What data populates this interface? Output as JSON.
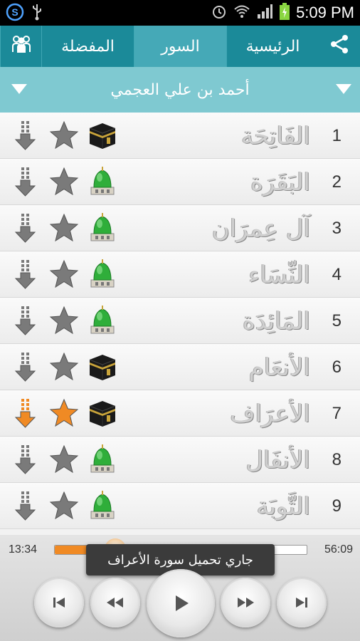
{
  "status_bar": {
    "time": "5:09 PM",
    "icons": [
      "app-s-icon",
      "usb-icon",
      "alarm-icon",
      "wifi-icon",
      "signal-icon",
      "battery-charging-icon"
    ]
  },
  "tabs": {
    "share_icon": "share-icon",
    "home": "الرئيسية",
    "surahs": "السور",
    "favorites": "المفضلة",
    "group_icon": "people-icon",
    "active": "surahs"
  },
  "reciter": {
    "name": "أحمد بن علي العجمي"
  },
  "surahs": [
    {
      "number": "1",
      "name": "الفَاتِحَة",
      "type": "kaaba-icon",
      "starred": false,
      "downloading": false
    },
    {
      "number": "2",
      "name": "البَقَرَة",
      "type": "mosque-icon",
      "starred": false,
      "downloading": false
    },
    {
      "number": "3",
      "name": "آل عِمرَان",
      "type": "mosque-icon",
      "starred": false,
      "downloading": false
    },
    {
      "number": "4",
      "name": "النِّسَاء",
      "type": "mosque-icon",
      "starred": false,
      "downloading": false
    },
    {
      "number": "5",
      "name": "المَائِدَة",
      "type": "mosque-icon",
      "starred": false,
      "downloading": false
    },
    {
      "number": "6",
      "name": "الأنعَام",
      "type": "kaaba-icon",
      "starred": false,
      "downloading": false
    },
    {
      "number": "7",
      "name": "الأعرَاف",
      "type": "kaaba-icon",
      "starred": true,
      "downloading": true
    },
    {
      "number": "8",
      "name": "الأنفَال",
      "type": "mosque-icon",
      "starred": false,
      "downloading": false
    },
    {
      "number": "9",
      "name": "التَّوبَة",
      "type": "mosque-icon",
      "starred": false,
      "downloading": false
    }
  ],
  "player": {
    "elapsed": "13:34",
    "total": "56:09",
    "progress": 0.24,
    "toast": "جاري تحميل سورة الأعراف",
    "buttons": [
      "skip-previous-icon",
      "rewind-icon",
      "play-icon",
      "fast-forward-icon",
      "skip-next-icon"
    ]
  },
  "colors": {
    "tab_bar": "#1b8a99",
    "tab_active": "#45a9b7",
    "reciter_bar": "#7fc9d1",
    "accent_orange": "#f08a24",
    "icon_grey": "#7a7a7a"
  }
}
